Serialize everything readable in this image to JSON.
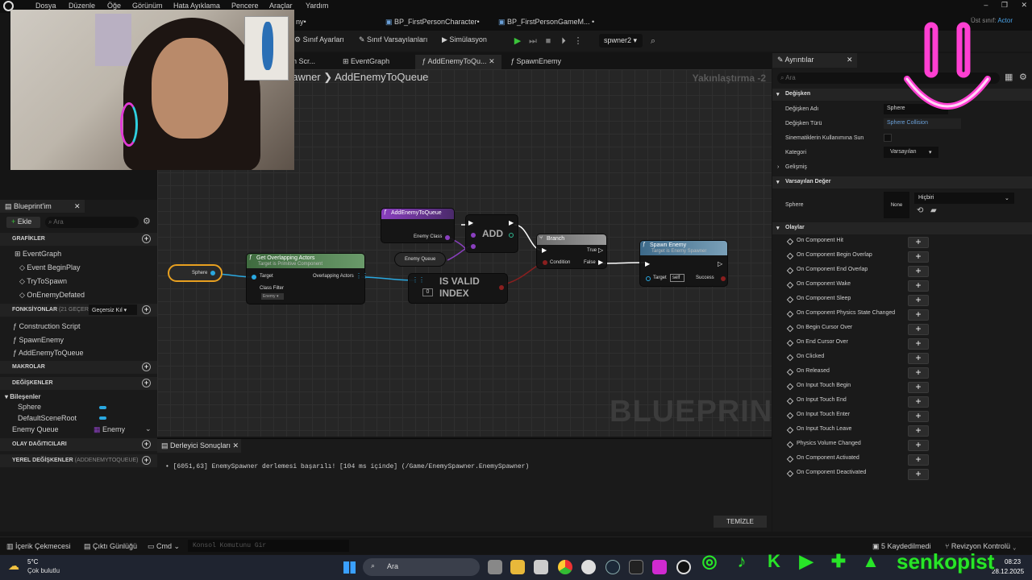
{
  "menu": [
    "Dosya",
    "Düzenle",
    "Öğe",
    "Görünüm",
    "Hata Ayıklama",
    "Pencere",
    "Araçlar",
    "Yardım"
  ],
  "titlebar": {
    "parent_class_label": "Üst sınıf:",
    "parent_class": "Actor",
    "partial_tab": "ny•"
  },
  "doc_tabs": [
    "BP_FirstPersonCharacter•",
    "BP_FirstPersonGameM... •"
  ],
  "toolbar": {
    "class_settings": "Sınıf Ayarları",
    "class_defaults": "Sınıf Varsayılanları",
    "simulation": "Simülasyon",
    "debug_target": "spwner2"
  },
  "graph_tabs": [
    "n Scr...",
    "EventGraph",
    "AddEnemyToQu...",
    "SpawnEnemy"
  ],
  "breadcrumb": {
    "parent": "pawner",
    "current": "AddEnemyToQueue"
  },
  "zoom": "Yakınlaştırma -2",
  "watermark": "BLUEPRINT",
  "nodes": {
    "entry": {
      "title": "AddEnemyToQueue",
      "pin": "Enemy Class"
    },
    "add": {
      "title": "ADD"
    },
    "queue_var": "Enemy Queue",
    "sphere_var": "Sphere",
    "overlap": {
      "title": "Get Overlapping Actors",
      "subtitle": "Target is Primitive Component",
      "target": "Target",
      "class_filter": "Class Filter",
      "overlapping": "Overlapping Actors",
      "filter_value": "Enemy"
    },
    "isvalid": {
      "line1": "IS VALID",
      "line2": "INDEX",
      "index": "0"
    },
    "branch": {
      "title": "Branch",
      "condition": "Condition",
      "true": "True",
      "false": "False"
    },
    "spawn": {
      "title": "Spawn Enemy",
      "subtitle": "Target is Enemy Spawner",
      "target": "Target",
      "self": "self",
      "success": "Success"
    }
  },
  "left": {
    "tab": "Blueprint'im",
    "add": "Ekle",
    "search_placeholder": "Ara",
    "graphs_header": "GRAFİKLER",
    "graph_root": "EventGraph",
    "graph_items": [
      "Event BeginPlay",
      "TryToSpawn",
      "OnEnemyDefated"
    ],
    "functions_header": "FONKSİYONLAR",
    "functions_count": "(21 GEÇERS",
    "override": "Geçersiz Kıl",
    "functions": [
      "Construction Script",
      "SpawnEnemy",
      "AddEnemyToQueue"
    ],
    "macros_header": "MAKROLAR",
    "variables_header": "DEĞİŞKENLER",
    "components_label": "Bileşenler",
    "components": [
      "Sphere",
      "DefaultSceneRoot"
    ],
    "var_name": "Enemy Queue",
    "var_type": "Enemy",
    "dispatchers_header": "OLAY DAĞITICILARI",
    "locals_header": "YEREL DEĞİŞKENLER",
    "locals_suffix": "(ADDENEMYTOQUEUE)"
  },
  "details": {
    "tab": "Ayrıntılar",
    "search_placeholder": "Ara",
    "variable_header": "Değişken",
    "var_name_label": "Değişken Adı",
    "var_name_value": "Sphere",
    "var_type_label": "Değişken Türü",
    "var_type_value": "Sphere Collision",
    "cinematic_label": "Sinematiklerin Kullanımına Sun",
    "category_label": "Kategori",
    "category_value": "Varsayılan",
    "advanced": "Gelişmiş",
    "default_header": "Varsayılan Değer",
    "sphere_label": "Sphere",
    "none_label": "None",
    "none_value": "Hiçbiri",
    "events_header": "Olaylar",
    "events": [
      "On Component Hit",
      "On Component Begin Overlap",
      "On Component End Overlap",
      "On Component Wake",
      "On Component Sleep",
      "On Component Physics State Changed",
      "On Begin Cursor Over",
      "On End Cursor Over",
      "On Clicked",
      "On Released",
      "On Input Touch Begin",
      "On Input Touch End",
      "On Input Touch Enter",
      "On Input Touch Leave",
      "Physics Volume Changed",
      "On Component Activated",
      "On Component Deactivated"
    ]
  },
  "compiler": {
    "tab": "Derleyici Sonuçları",
    "message": "[6051,63] EnemySpawner derlemesi başarılı! [104 ms içinde] (/Game/EnemySpawner.EnemySpawner)",
    "clear": "TEMİZLE"
  },
  "statusbar": {
    "content_drawer": "İçerik Çekmecesi",
    "output_log": "Çıktı Günlüğü",
    "cmd": "Cmd",
    "console_placeholder": "Konsol Komutunu Gir",
    "saved": "5 Kaydedilmedi",
    "revision": "Revizyon Kontrolü"
  },
  "taskbar": {
    "temp": "5°C",
    "weather": "Çok bulutlu",
    "search": "Ara",
    "time": "08:23",
    "date": "28.12.2025"
  },
  "overlay": {
    "brand": "senkopist"
  },
  "colors": {
    "accent_blue": "#2aa8e0",
    "exec_white": "#ffffff",
    "node_green": "#3f6b3f",
    "func_blue": "#3d6a8a",
    "purple": "#8a3fbf",
    "brand_green": "#28e528",
    "smiley_pink": "#ff3fd2"
  }
}
